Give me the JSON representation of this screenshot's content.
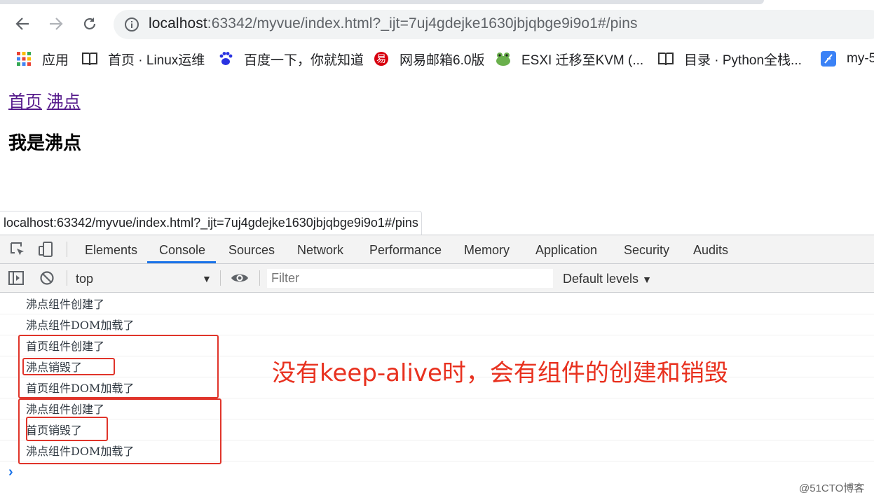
{
  "browser": {
    "url_host": "localhost",
    "url_rest": ":63342/myvue/index.html?_ijt=7uj4gdejke1630jbjqbge9i9o1#/pins",
    "bookmarks": [
      {
        "label": "应用",
        "icon": "apps-grid-icon"
      },
      {
        "label": "首页 · Linux运维",
        "icon": "book-icon"
      },
      {
        "label": "百度一下，你就知道",
        "icon": "baidu-paw-icon"
      },
      {
        "label": "网易邮箱6.0版",
        "icon": "netease-icon"
      },
      {
        "label": "ESXI 迁移至KVM (...",
        "icon": "frog-icon"
      },
      {
        "label": "目录 · Python全栈...",
        "icon": "book-icon"
      },
      {
        "label": "my-5",
        "icon": "feather-icon"
      }
    ]
  },
  "page": {
    "nav_home": "首页",
    "nav_pins": "沸点",
    "heading": "我是沸点"
  },
  "status_bar": {
    "url": "localhost:63342/myvue/index.html?_ijt=7uj4gdejke1630jbjqbge9i9o1#/pins"
  },
  "devtools": {
    "tabs": [
      "Elements",
      "Console",
      "Sources",
      "Network",
      "Performance",
      "Memory",
      "Application",
      "Security",
      "Audits"
    ],
    "active_tab": "Console",
    "context": "top",
    "filter_placeholder": "Filter",
    "levels": "Default levels",
    "logs": [
      "沸点组件创建了",
      "沸点组件DOM加载了",
      "首页组件创建了",
      "沸点销毁了",
      "首页组件DOM加载了",
      "沸点组件创建了",
      "首页销毁了",
      "沸点组件DOM加载了"
    ]
  },
  "annotation": {
    "text": "没有keep-alive时，会有组件的创建和销毁",
    "color": "#e8311f"
  },
  "watermark": "@51CTO博客"
}
